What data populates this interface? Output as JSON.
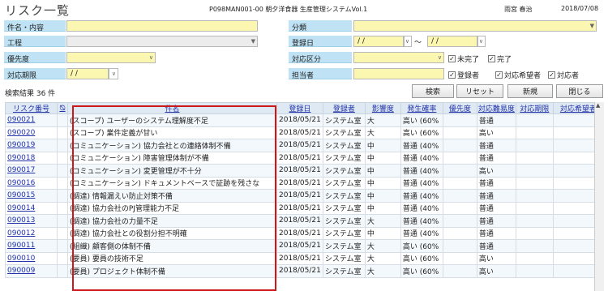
{
  "header": {
    "title": "リスク一覧",
    "system_id": "P098MAN001-00 朝夕洋食器 生産管理システムVol.1",
    "user": "雨宮 春治",
    "date": "2018/07/08"
  },
  "form": {
    "subject_label": "件名・内容",
    "category_label": "分類",
    "process_label": "工程",
    "reg_date_label": "登録日",
    "reg_date_from": " / / ",
    "reg_date_tilde": "〜",
    "reg_date_to": " / / ",
    "priority_label": "優先度",
    "status_label": "対応区分",
    "status_unfinished": "未完了",
    "status_finished": "完了",
    "deadline_label": "対応期限",
    "deadline_value": " / / ",
    "assignee_label": "担当者",
    "chk_registrant": "登録者",
    "chk_desired": "対応希望者",
    "chk_handler": "対応者"
  },
  "buttons": {
    "search": "検索",
    "reset": "リセット",
    "new": "新規",
    "close": "閉じる"
  },
  "result": "検索結果 36 件",
  "table": {
    "columns": [
      "リスク番号",
      "",
      "件名",
      "登録日",
      "登録者",
      "影響度",
      "発生確率",
      "優先度",
      "対応難易度",
      "対応期限",
      "対応希望者"
    ],
    "rows": [
      [
        "090021",
        "",
        "(スコープ) ユーザーのシステム理解度不足",
        "2018/05/21",
        "システム室",
        "大",
        "高い (60%",
        "",
        "普通",
        "",
        ""
      ],
      [
        "090020",
        "",
        "(スコープ) 業件定義が甘い",
        "2018/05/21",
        "システム室",
        "大",
        "高い (60%",
        "",
        "高い",
        "",
        ""
      ],
      [
        "090019",
        "",
        "(コミュニケーション) 協力会社との連絡体制不備",
        "2018/05/21",
        "システム室",
        "中",
        "普通 (40%",
        "",
        "普通",
        "",
        ""
      ],
      [
        "090018",
        "",
        "(コミュニケーション) 障害管理体制が不備",
        "2018/05/21",
        "システム室",
        "中",
        "普通 (40%",
        "",
        "普通",
        "",
        ""
      ],
      [
        "090017",
        "",
        "(コミュニケーション) 変更管理が不十分",
        "2018/05/21",
        "システム室",
        "中",
        "普通 (40%",
        "",
        "高い",
        "",
        ""
      ],
      [
        "090016",
        "",
        "(コミュニケーション) ドキュメントベースで証跡を残さな",
        "2018/05/21",
        "システム室",
        "中",
        "普通 (40%",
        "",
        "普通",
        "",
        ""
      ],
      [
        "090015",
        "",
        "(調達) 情報漏えい防止対策不備",
        "2018/05/21",
        "システム室",
        "中",
        "普通 (40%",
        "",
        "普通",
        "",
        ""
      ],
      [
        "090014",
        "",
        "(調達) 協力会社のPJ管理能力不足",
        "2018/05/21",
        "システム室",
        "中",
        "普通 (40%",
        "",
        "普通",
        "",
        ""
      ],
      [
        "090013",
        "",
        "(調達) 協力会社の力量不足",
        "2018/05/21",
        "システム室",
        "大",
        "普通 (40%",
        "",
        "普通",
        "",
        ""
      ],
      [
        "090012",
        "",
        "(調達) 協力会社との役割分担不明確",
        "2018/05/21",
        "システム室",
        "中",
        "普通 (40%",
        "",
        "普通",
        "",
        ""
      ],
      [
        "090011",
        "",
        "(組織) 顧客側の体制不備",
        "2018/05/21",
        "システム室",
        "大",
        "高い (60%",
        "",
        "普通",
        "",
        ""
      ],
      [
        "090010",
        "",
        "(要員) 要員の技術不足",
        "2018/05/21",
        "システム室",
        "大",
        "高い (60%",
        "",
        "高い",
        "",
        ""
      ],
      [
        "090009",
        "",
        "(要員) プロジェクト体制不備",
        "2018/05/21",
        "システム室",
        "大",
        "高い (60%",
        "",
        "高い",
        "",
        ""
      ]
    ]
  },
  "colors": {
    "label_bg": "#bfe3f5",
    "input_yellow": "#fbf6b0",
    "highlight": "#cc1818",
    "link": "#2233aa"
  }
}
